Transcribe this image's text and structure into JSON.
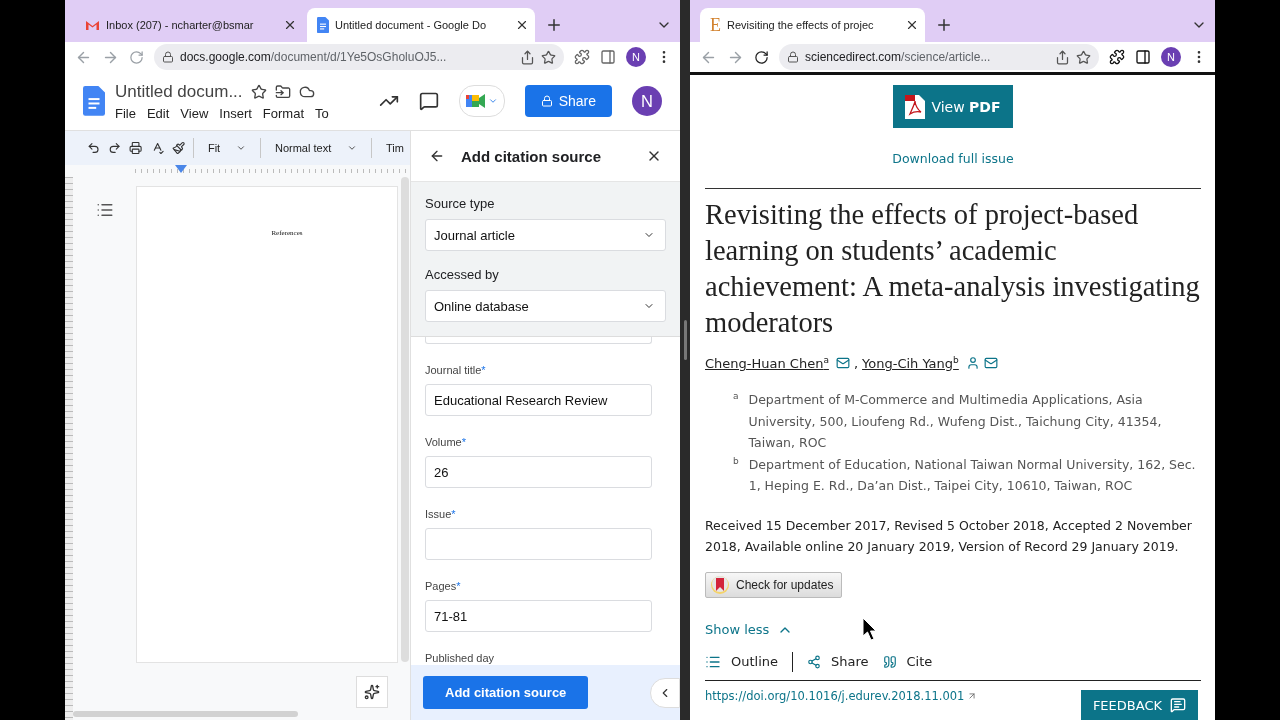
{
  "left_window": {
    "tabs": [
      {
        "kind": "mail",
        "title": "Inbox (207) - ncharter@bsmar",
        "selected": false
      },
      {
        "kind": "docs",
        "title": "Untitled document - Google Do",
        "selected": true
      }
    ],
    "address": {
      "host": "docs.google.com",
      "path": "/document/d/1Ye5OsGholuOJ5..."
    },
    "profile": "N",
    "doc": {
      "title": "Untitled docum...",
      "menu": [
        "File",
        "Edit",
        "View",
        "Insert",
        "Format",
        "To"
      ],
      "share": "Share",
      "avatar": "N"
    },
    "toolbar": {
      "dropdowns": [
        "Fit",
        "Normal text",
        "Tim"
      ]
    },
    "page_text": "References",
    "citation_panel": {
      "title": "Add citation source",
      "selects": [
        {
          "label": "Source type",
          "value": "Journal article"
        },
        {
          "label": "Accessed by",
          "value": "Online database"
        }
      ],
      "fields": [
        {
          "label": "Journal title",
          "mark": "*",
          "value": "Educational Research Review"
        },
        {
          "label": "Volume",
          "mark": "*",
          "value": "26"
        },
        {
          "label": "Issue",
          "mark": "*"
        },
        {
          "label": "Pages",
          "mark": "*",
          "value": "71-81"
        }
      ],
      "next_label": "Published day",
      "submit": "Add citation source"
    }
  },
  "right_window": {
    "tabs": [
      {
        "kind": "article",
        "favicon": "E",
        "title": "Revisiting the effects of projec",
        "selected": true
      }
    ],
    "address": {
      "host": "sciencedirect.com",
      "path": "/science/article..."
    },
    "profile": "N",
    "pdf_button": {
      "text": "View ",
      "bold": "PDF"
    },
    "download": "Download full issue",
    "title": "Revisiting the effects of project-based learning on students’ academic achievement: A meta-analysis investigating moderators",
    "authors": [
      {
        "name": "Cheng-Huan Chen",
        "sup": "a",
        "has_profile": false,
        "has_email": true
      },
      {
        "name": "Yong-Cih Yang",
        "sup": "b",
        "has_profile": true,
        "has_email": true
      }
    ],
    "author_separator": ",",
    "affiliations": [
      {
        "label": "a",
        "text": "Department of M-Commerce and Multimedia Applications, Asia University, 500, Lioufeng Rd., Wufeng Dist., Taichung City, 41354, Taiwan, ROC"
      },
      {
        "label": "b",
        "text": "Department of Education, National Taiwan Normal University, 162, Sec. 1, Heping E. Rd., Da’an Dist., Taipei City, 10610, Taiwan, ROC"
      }
    ],
    "dates": "Received 15 December 2017, Revised 5 October 2018, Accepted 2 November 2018, Available online 20 January 2019, Version of Record 29 January 2019.",
    "check_updates": "Check for updates",
    "show_less": {
      "label": "Show less",
      "expanded": true
    },
    "actions": [
      {
        "kind": "outline",
        "label": "Outline"
      },
      {
        "kind": "share",
        "label": "Share"
      },
      {
        "kind": "cite",
        "label": "Cite"
      }
    ],
    "doi": "https://doi.org/10.1016/j.edurev.2018.11.001",
    "feedback": "FEEDBACK"
  }
}
